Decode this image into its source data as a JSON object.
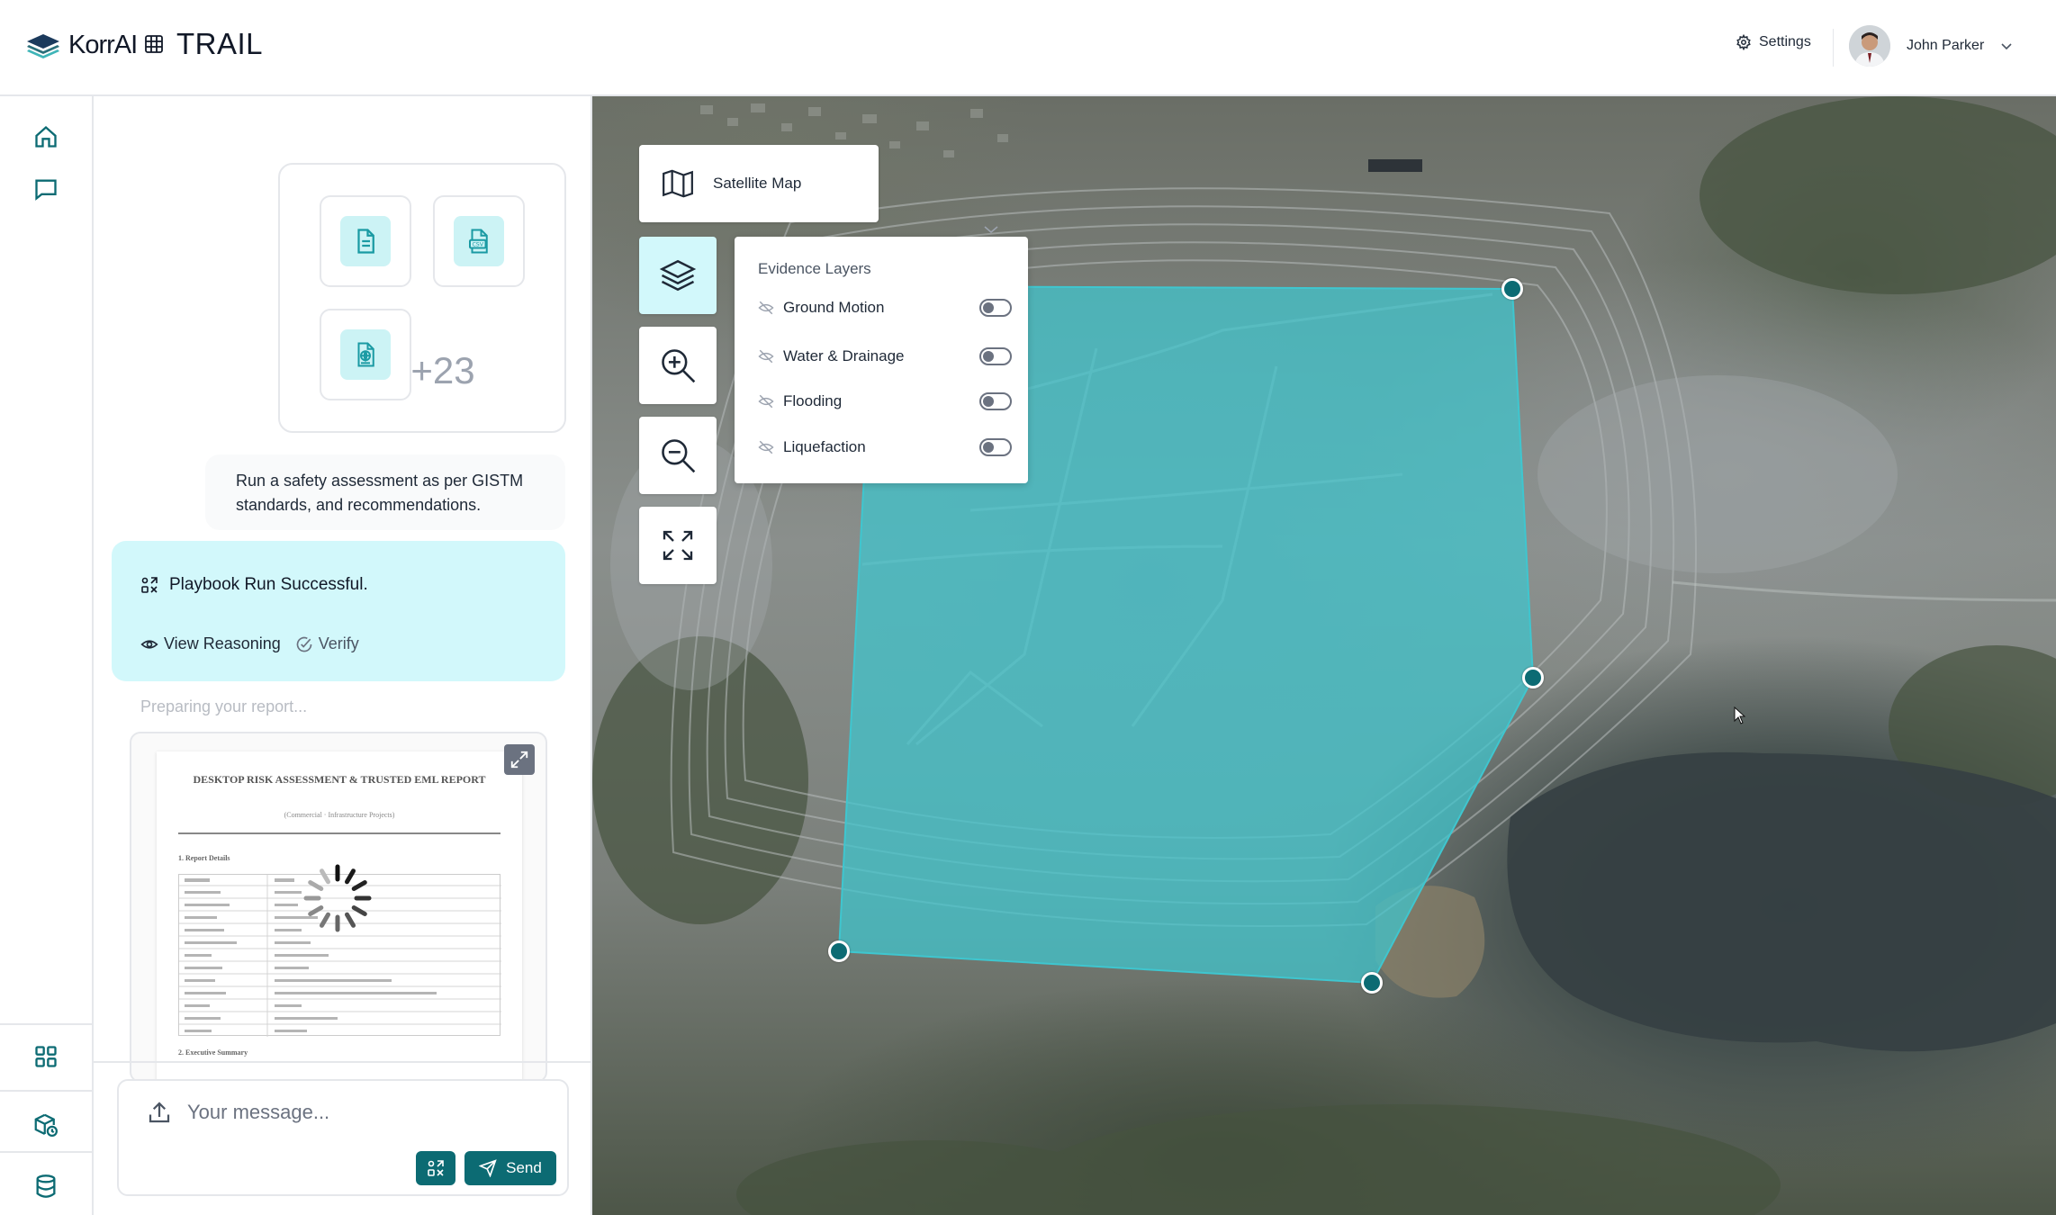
{
  "header": {
    "brand": "KorrAI",
    "app_name": "TRAIL",
    "settings_label": "Settings",
    "user_name": "John Parker"
  },
  "nav": {
    "top_items": [
      "home-icon",
      "chat-icon"
    ],
    "bottom_items": [
      "grid-icon",
      "box-clock-icon",
      "database-icon"
    ]
  },
  "chat": {
    "attachments": [
      "document-icon",
      "csv-icon",
      "web-document-icon"
    ],
    "more_count": "+23",
    "user_message": "Run a safety assessment as per GISTM standards, and recommendations.",
    "result_title": "Playbook Run Successful.",
    "view_reasoning": "View Reasoning",
    "verify": "Verify",
    "preparing": "Preparing your report...",
    "report_preview": {
      "title": "DESKTOP RISK ASSESSMENT & TRUSTED EML REPORT",
      "subtitle": "(Commercial · Infrastructure Projects)",
      "section1": "1. Report Details",
      "section2": "2. Executive Summary"
    },
    "composer": {
      "placeholder": "Your message...",
      "send_label": "Send"
    }
  },
  "map": {
    "basemap_label": "Satellite Map",
    "layers_title": "Evidence Layers",
    "layers": [
      {
        "name": "Ground Motion",
        "enabled": false
      },
      {
        "name": "Water & Drainage",
        "enabled": false
      },
      {
        "name": "Flooding",
        "enabled": false
      },
      {
        "name": "Liquefaction",
        "enabled": false
      }
    ],
    "polygon_color": "#3fc6cf",
    "accent": "#0c6b73"
  }
}
